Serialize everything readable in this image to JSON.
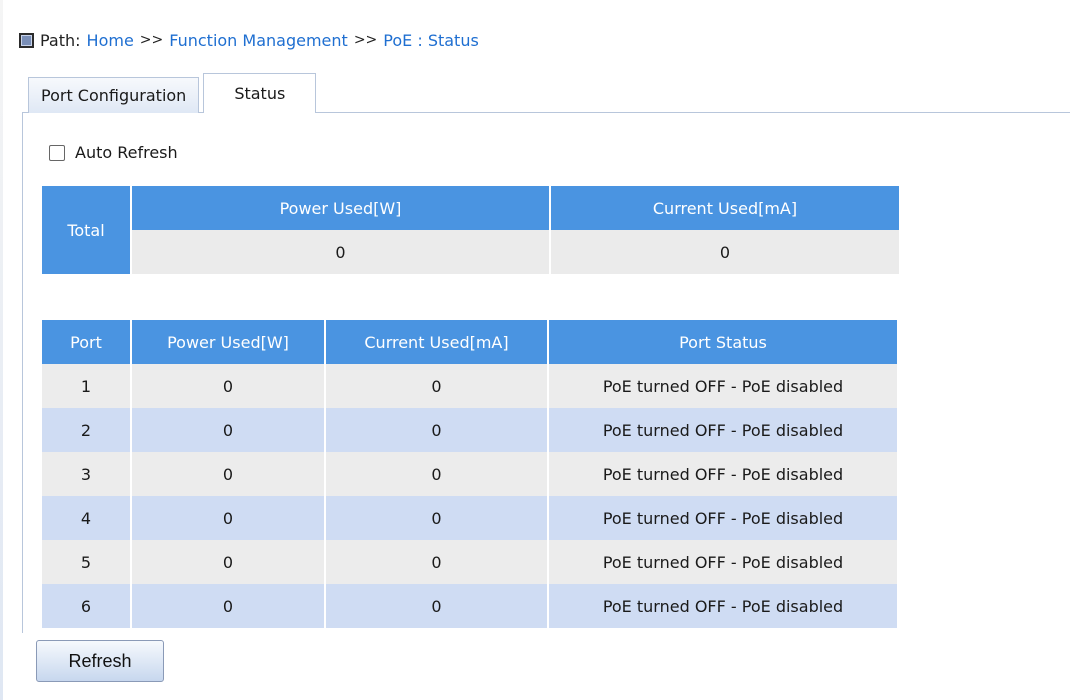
{
  "breadcrumb": {
    "label": "Path:",
    "items": [
      "Home",
      "Function Management",
      "PoE : Status"
    ],
    "separator": ">>"
  },
  "tabs": [
    {
      "label": "Port Configuration",
      "active": false
    },
    {
      "label": "Status",
      "active": true
    }
  ],
  "auto_refresh": {
    "label": "Auto Refresh",
    "checked": false
  },
  "total_table": {
    "row_label": "Total",
    "headers": [
      "Power Used[W]",
      "Current Used[mA]"
    ],
    "values": [
      "0",
      "0"
    ]
  },
  "port_table": {
    "headers": [
      "Port",
      "Power Used[W]",
      "Current Used[mA]",
      "Port Status"
    ],
    "rows": [
      [
        "1",
        "0",
        "0",
        "PoE turned OFF - PoE disabled"
      ],
      [
        "2",
        "0",
        "0",
        "PoE turned OFF - PoE disabled"
      ],
      [
        "3",
        "0",
        "0",
        "PoE turned OFF - PoE disabled"
      ],
      [
        "4",
        "0",
        "0",
        "PoE turned OFF - PoE disabled"
      ],
      [
        "5",
        "0",
        "0",
        "PoE turned OFF - PoE disabled"
      ],
      [
        "6",
        "0",
        "0",
        "PoE turned OFF - PoE disabled"
      ]
    ]
  },
  "buttons": {
    "refresh": "Refresh"
  },
  "colors": {
    "header_blue": "#4a94e1",
    "link_blue": "#1f6fd1",
    "row_gray": "#ececec",
    "row_blue": "#cfdcf3"
  }
}
